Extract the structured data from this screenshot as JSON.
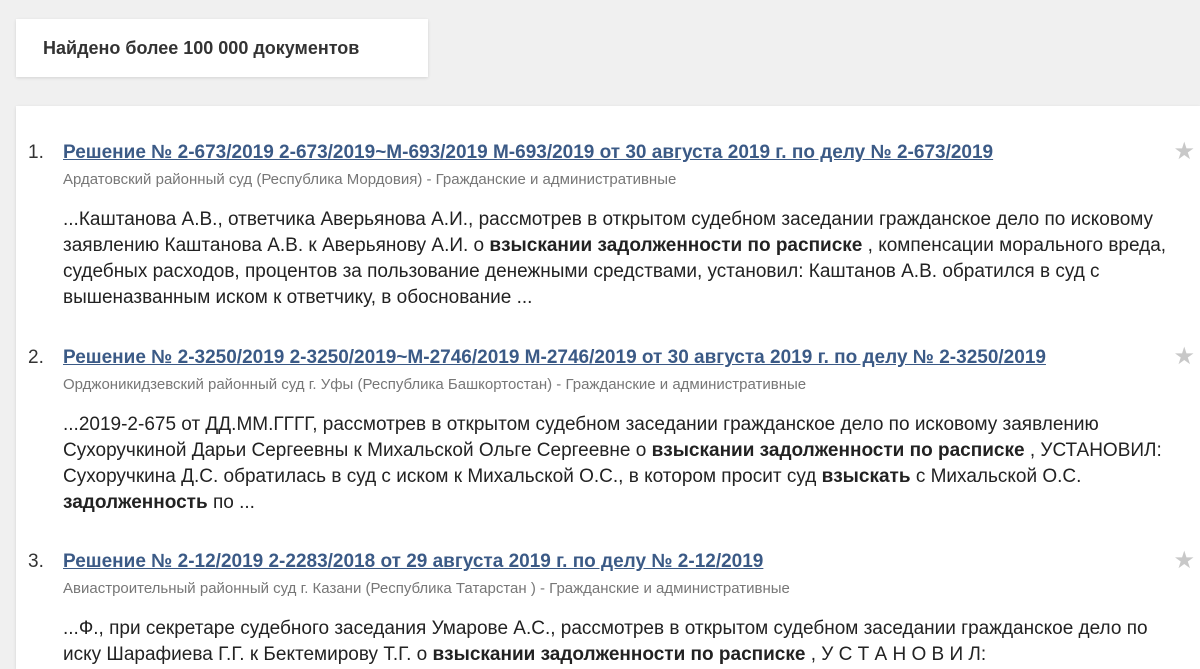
{
  "summary": {
    "count_text": "Найдено более 100 000 документов"
  },
  "results": [
    {
      "num": "1.",
      "title": "Решение № 2-673/2019 2-673/2019~М-693/2019 М-693/2019 от 30 августа 2019 г. по делу № 2-673/2019",
      "court": "Ардатовский районный суд (Республика Мордовия)",
      "separator": " - ",
      "category": "Гражданские и административные",
      "snippet": [
        {
          "t": "...Каштанова А.В., ответчика Аверьянова А.И., рассмотрев в открытом судебном заседании гражданское дело по исковому заявлению Каштанова А.В. к Аверьянову А.И. о ",
          "b": false
        },
        {
          "t": "взыскании задолженности по расписке",
          "b": true
        },
        {
          "t": " , компенсации морального вреда, судебных расходов, процентов за пользование денежными средствами, установил: Каштанов А.В. обратился в суд с вышеназванным иском к ответчику, в обоснование ...",
          "b": false
        }
      ]
    },
    {
      "num": "2.",
      "title": "Решение № 2-3250/2019 2-3250/2019~М-2746/2019 М-2746/2019 от 30 августа 2019 г. по делу № 2-3250/2019",
      "court": "Орджоникидзевский районный суд г. Уфы (Республика Башкортостан)",
      "separator": " - ",
      "category": "Гражданские и административные",
      "snippet": [
        {
          "t": "...2019-2-675 от ДД.ММ.ГГГГ, рассмотрев в открытом судебном заседании гражданское дело по исковому заявлению Сухоручкиной Дарьи Сергеевны к Михальской Ольге Сергеевне о ",
          "b": false
        },
        {
          "t": "взыскании задолженности по расписке",
          "b": true
        },
        {
          "t": " , УСТАНОВИЛ: Сухоручкина Д.С. обратилась в суд с иском к Михальской О.С., в котором просит суд ",
          "b": false
        },
        {
          "t": "взыскать",
          "b": true
        },
        {
          "t": " с Михальской О.С. ",
          "b": false
        },
        {
          "t": "задолженность",
          "b": true
        },
        {
          "t": " по ...",
          "b": false
        }
      ]
    },
    {
      "num": "3.",
      "title": "Решение № 2-12/2019 2-2283/2018 от 29 августа 2019 г. по делу № 2-12/2019",
      "court": "Авиастроительный районный суд г. Казани (Республика Татарстан )",
      "separator": " - ",
      "category": "Гражданские и административные",
      "snippet": [
        {
          "t": "...Ф., при секретаре судебного заседания Умарове А.С., рассмотрев в открытом судебном заседании гражданское дело по иску Шарафиева Г.Г. к Бектемирову Т.Г. о ",
          "b": false
        },
        {
          "t": "взыскании задолженности по расписке",
          "b": true
        },
        {
          "t": " , У С Т А Н О В И Л:",
          "b": false
        }
      ]
    }
  ],
  "icons": {
    "star": "star-icon"
  },
  "colors": {
    "link": "#3b5a86",
    "meta": "#777777",
    "star": "#c8c8c8",
    "background": "#f0f0f0"
  }
}
